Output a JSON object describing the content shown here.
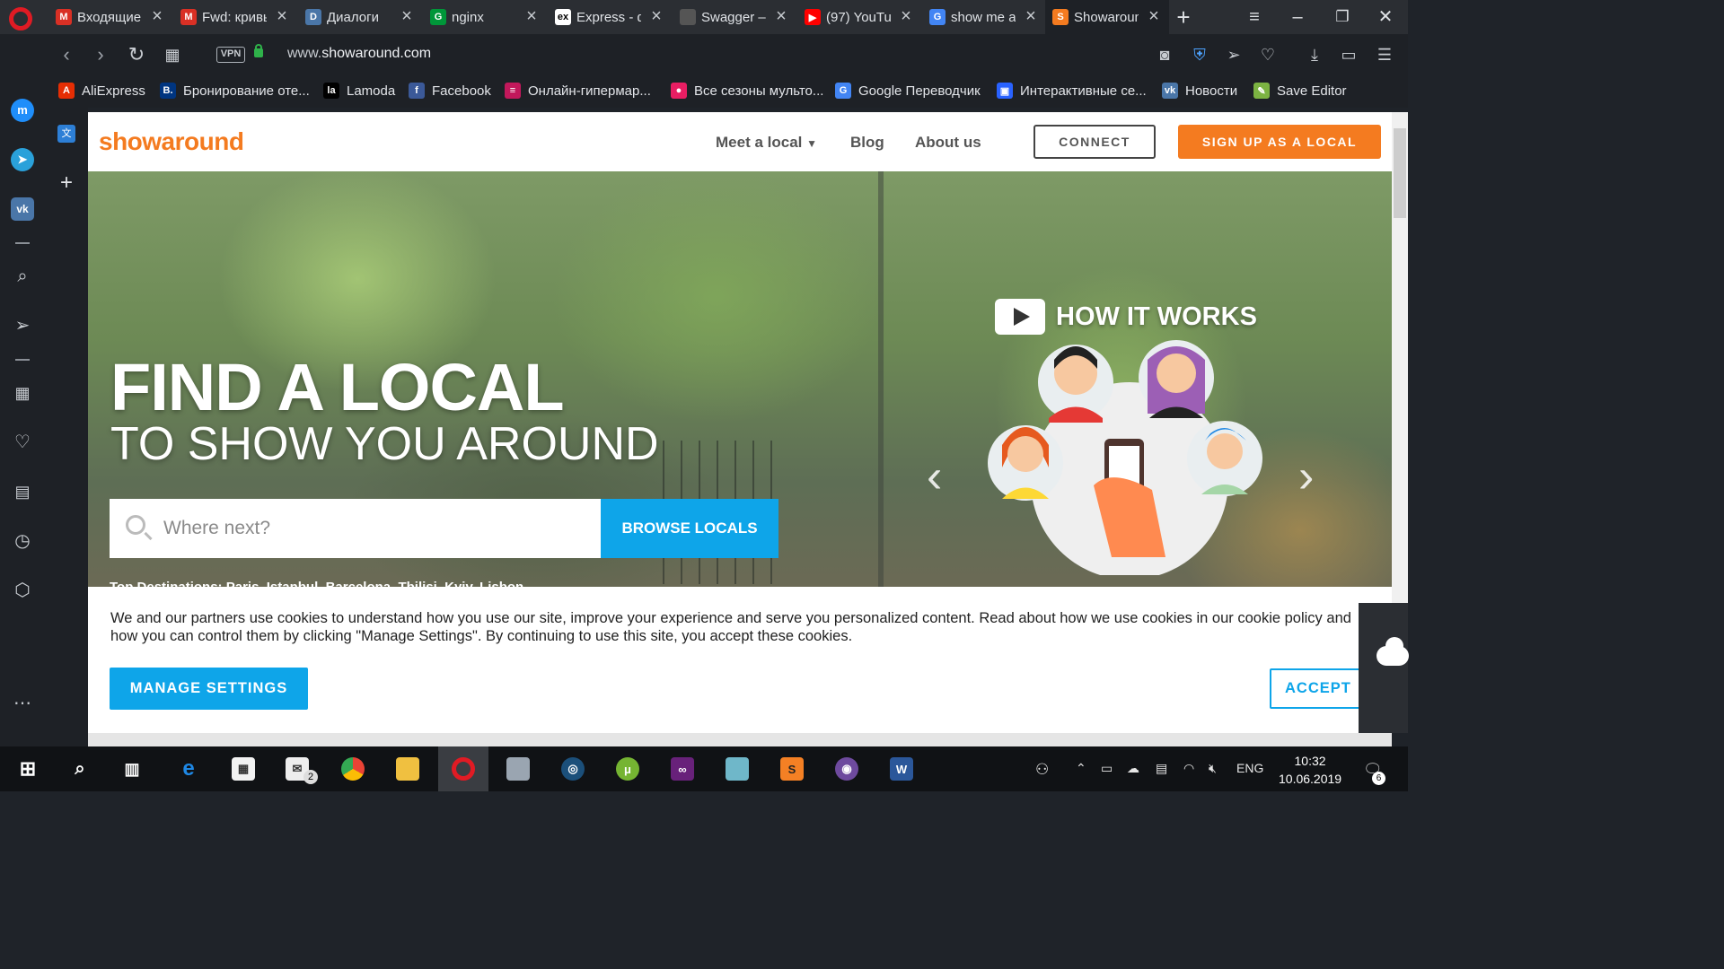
{
  "browser": {
    "tabs": [
      {
        "title": "Входящие",
        "icon": "gmail-icon",
        "color": "#d93025",
        "glyph": "M"
      },
      {
        "title": "Fwd: кривь",
        "icon": "gmail-icon",
        "color": "#d93025",
        "glyph": "M"
      },
      {
        "title": "Диалоги",
        "icon": "chat-icon",
        "color": "#4a76a8",
        "glyph": "D"
      },
      {
        "title": "nginx",
        "icon": "nginx-icon",
        "color": "#009639",
        "glyph": "G"
      },
      {
        "title": "Express - ф",
        "icon": "express-icon",
        "color": "#ffffff",
        "glyph": "ex"
      },
      {
        "title": "Swagger –",
        "icon": "loading-icon",
        "color": "#555555",
        "glyph": ""
      },
      {
        "title": "(97) YouTul",
        "icon": "youtube-icon",
        "color": "#ff0000",
        "glyph": "▶"
      },
      {
        "title": "show me a",
        "icon": "google-icon",
        "color": "#4285f4",
        "glyph": "G"
      },
      {
        "title": "Showaroun",
        "icon": "showaround-icon",
        "color": "#f47b20",
        "glyph": "S",
        "active": true
      }
    ],
    "url_prefix": "www.",
    "url_domain": "showaround.com",
    "vpn_label": "VPN",
    "bookmarks": [
      {
        "label": "AliExpress",
        "color": "#e62e04",
        "glyph": "A"
      },
      {
        "label": "Бронирование оте...",
        "color": "#003580",
        "glyph": "B."
      },
      {
        "label": "Lamoda",
        "color": "#000000",
        "glyph": "la"
      },
      {
        "label": "Facebook",
        "color": "#3b5998",
        "glyph": "f"
      },
      {
        "label": "Онлайн-гипермар...",
        "color": "#c2185b",
        "glyph": "≡"
      },
      {
        "label": "Все сезоны мульто...",
        "color": "#e91e63",
        "glyph": "●"
      },
      {
        "label": "Google Переводчик",
        "color": "#4285f4",
        "glyph": "G"
      },
      {
        "label": "Интерактивные се...",
        "color": "#2962ff",
        "glyph": "▣"
      },
      {
        "label": "Новости",
        "color": "#4a76a8",
        "glyph": "vk"
      },
      {
        "label": "Save Editor",
        "color": "#7cb342",
        "glyph": "✎"
      }
    ]
  },
  "site": {
    "logo": "showaround",
    "nav": {
      "meet": "Meet a local",
      "blog": "Blog",
      "about": "About us"
    },
    "connect": "CONNECT",
    "signup": "SIGN UP AS A LOCAL",
    "hero_title": "FIND A LOCAL",
    "hero_subtitle": "TO SHOW YOU AROUND",
    "search_placeholder": "Where next?",
    "browse": "BROWSE LOCALS",
    "top_destinations": "Top Destinations: Paris, Istanbul, Barcelona, Tbilisi, Kyiv, Lisbon",
    "how_it_works": "HOW IT WORKS"
  },
  "cookie": {
    "text": "We and our partners use cookies to understand how you use our site, improve your experience and serve you personalized content. Read about how we use cookies in our cookie policy and how you can control them by clicking \"Manage Settings\". By continuing to use this site, you accept these cookies.",
    "manage": "MANAGE SETTINGS",
    "accept": "ACCEPT"
  },
  "taskbar": {
    "lang": "ENG",
    "time": "10:32",
    "date": "10.06.2019",
    "mail_badge": "2",
    "notif_badge": "6"
  },
  "colors": {
    "brand": "#f47b20",
    "accent": "#0ea5e9"
  }
}
